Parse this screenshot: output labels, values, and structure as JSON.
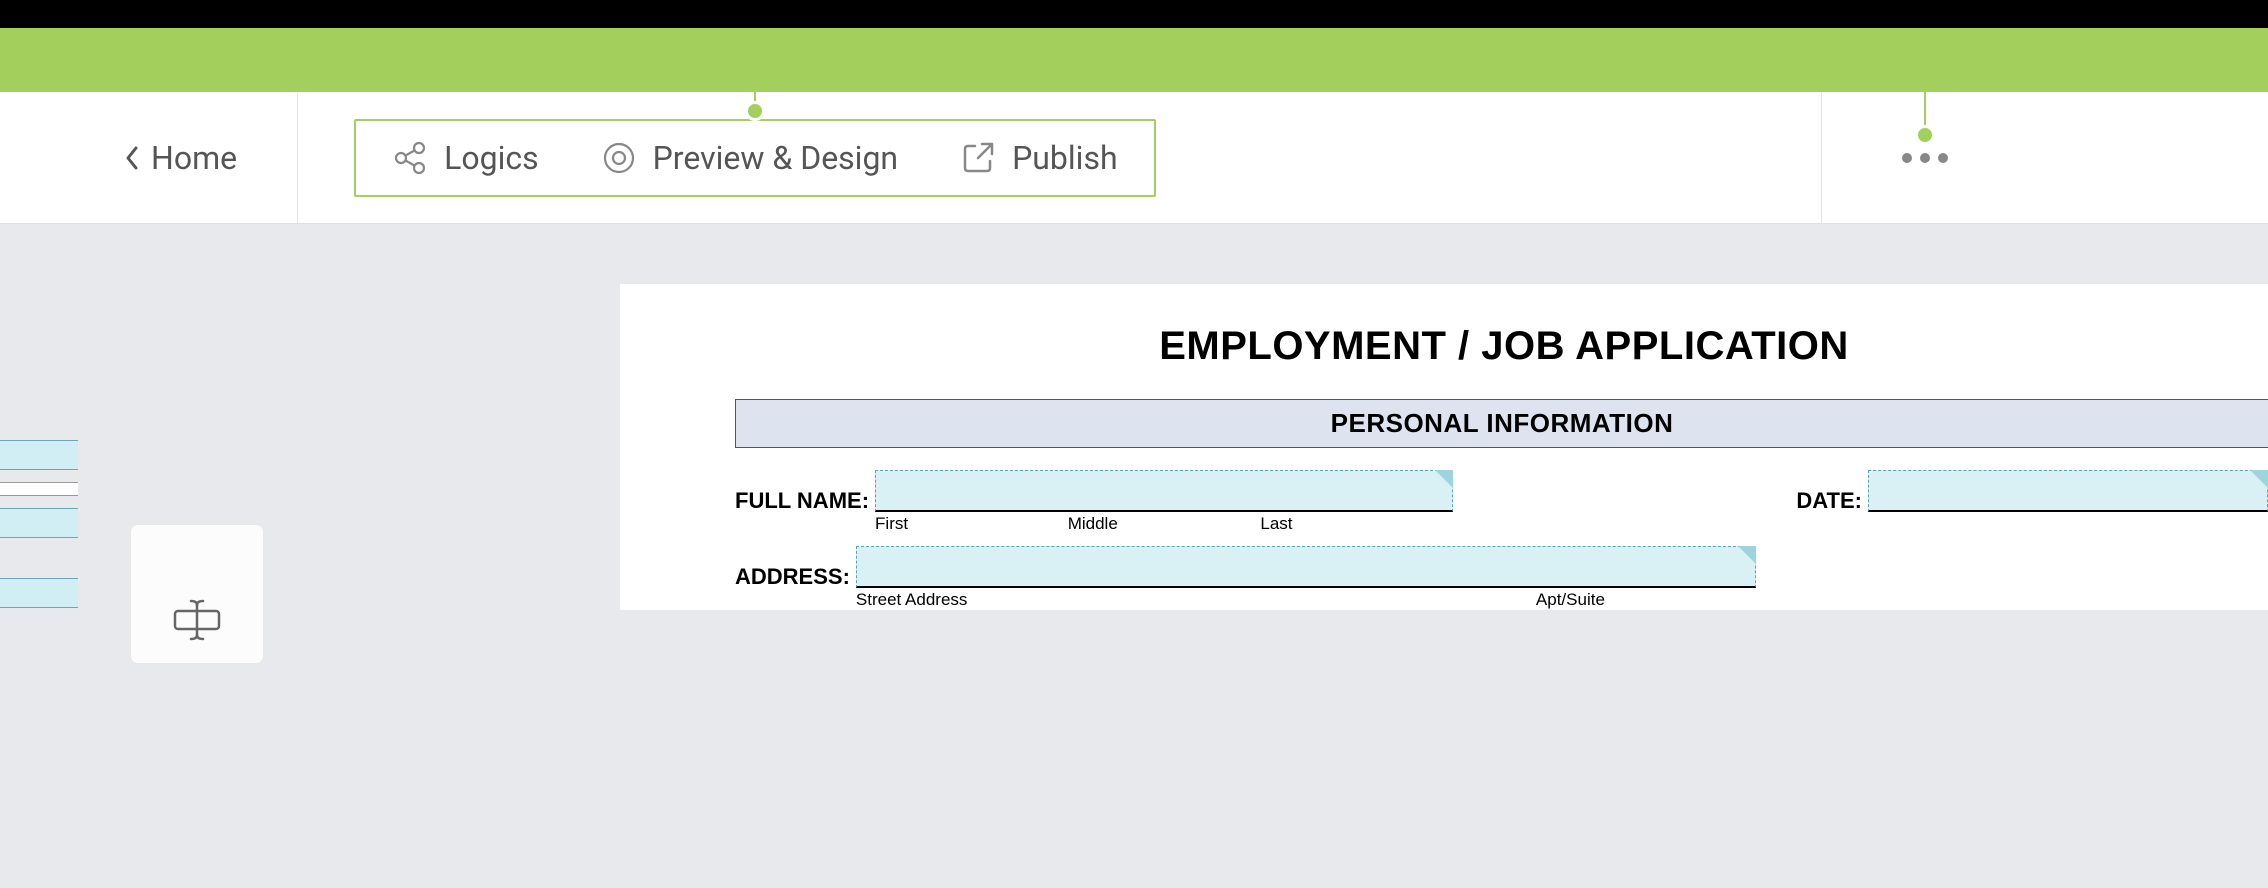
{
  "toolbar": {
    "home_label": "Home",
    "logics_label": "Logics",
    "preview_label": "Preview & Design",
    "publish_label": "Publish"
  },
  "form": {
    "title": "EMPLOYMENT / JOB APPLICATION",
    "section_header": "PERSONAL INFORMATION",
    "full_name_label": "FULL NAME:",
    "date_label": "DATE:",
    "address_label": "ADDRESS:",
    "name_sub_first": "First",
    "name_sub_middle": "Middle",
    "name_sub_last": "Last",
    "address_sub_street": "Street Address",
    "address_sub_apt": "Apt/Suite"
  }
}
